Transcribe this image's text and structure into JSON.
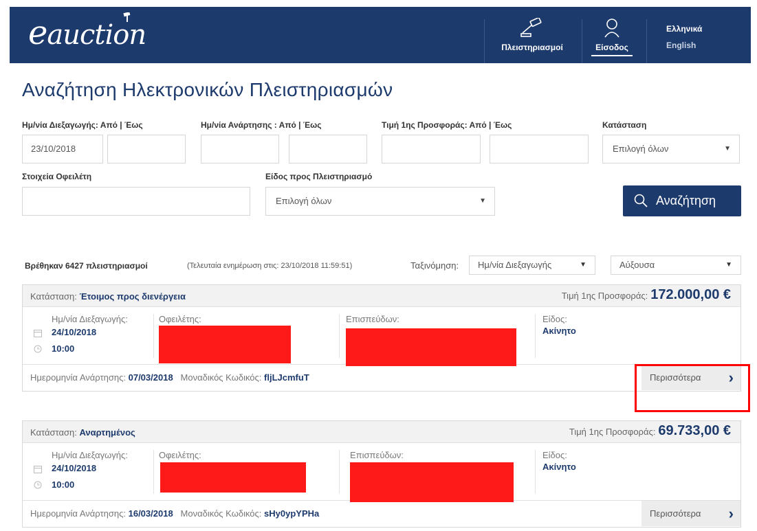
{
  "header": {
    "logo_e": "e",
    "logo_rest": "auction",
    "nav_auctions": "Πλειστηριασμοί",
    "nav_login": "Είσοδος",
    "lang_el": "Ελληνικά",
    "lang_en": "English",
    "bg_color": "#1d3a6d"
  },
  "page_title": "Αναζήτηση Ηλεκτρονικών Πλειστηριασμών",
  "filters": {
    "date_label": "Ημ/νία Διεξαγωγής: Από | Έως",
    "date_from": "23/10/2018",
    "date_to": "",
    "posted_label": "Ημ/νία Ανάρτησης : Από | Έως",
    "posted_from": "",
    "posted_to": "",
    "price_label": "Τιμή 1ης Προσφοράς: Από | Έως",
    "price_from": "",
    "price_to": "",
    "status_label": "Κατάσταση",
    "status_value": "Επιλογή όλων",
    "debtor_label": "Στοιχεία Οφειλέτη",
    "debtor_value": "",
    "type_label": "Είδος προς Πλειστηριασμό",
    "type_value": "Επιλογή όλων",
    "search_button": "Αναζήτηση"
  },
  "results": {
    "count_text": "Βρέθηκαν 6427 πλειστηριασμοί",
    "updated_text": "(Τελευταία ενημέρωση στις: 23/10/2018 11:59:51)",
    "sort_label": "Ταξινόμηση:",
    "sort_field": "Ημ/νία Διεξαγωγής",
    "sort_order": "Αύξουσα"
  },
  "labels": {
    "status": "Κατάσταση:",
    "price": "Τιμή 1ης Προσφοράς:",
    "date": "Ημ/νία Διεξαγωγής:",
    "debtor": "Οφειλέτης:",
    "creditor": "Επισπεύδων:",
    "type": "Είδος:",
    "posted": "Ημερομηνία Ανάρτησης:",
    "code": "Μοναδικός Κωδικός:",
    "more": "Περισσότερα"
  },
  "auctions": [
    {
      "status": "Έτοιμος προς διενέργεια",
      "price": "172.000,00 €",
      "date": "24/10/2018",
      "time": "10:00",
      "type": "Ακίνητο",
      "posted": "07/03/2018",
      "code": "fljLJcmfuT"
    },
    {
      "status": "Αναρτημένος",
      "price": "69.733,00 €",
      "date": "24/10/2018",
      "time": "10:00",
      "type": "Ακίνητο",
      "posted": "16/03/2018",
      "code": "sHy0ypYPHa"
    }
  ]
}
